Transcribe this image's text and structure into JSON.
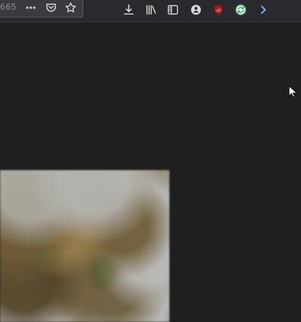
{
  "toolbar": {
    "url_fragment": "665",
    "icons": {
      "more": "more-icon",
      "pocket": "pocket-icon",
      "bookmark": "star-icon",
      "download": "download-icon",
      "library": "library-icon",
      "sidebar": "sidebar-icon",
      "account": "account-icon",
      "ublock": "ublock-icon",
      "sync": "sync-extension-icon",
      "overflow": "chevron-right-icon"
    }
  },
  "content": {
    "image_region": "blurred-photo"
  },
  "colors": {
    "page_background": "#1f1f1f",
    "toolbar_background": "#2a2a2e",
    "urlbar_background": "#3b3a40",
    "icon_color": "#d9d9da",
    "ublock_red": "#9e1f1f",
    "sync_green": "#4ea56b",
    "accent_blue": "#64a9ff"
  }
}
